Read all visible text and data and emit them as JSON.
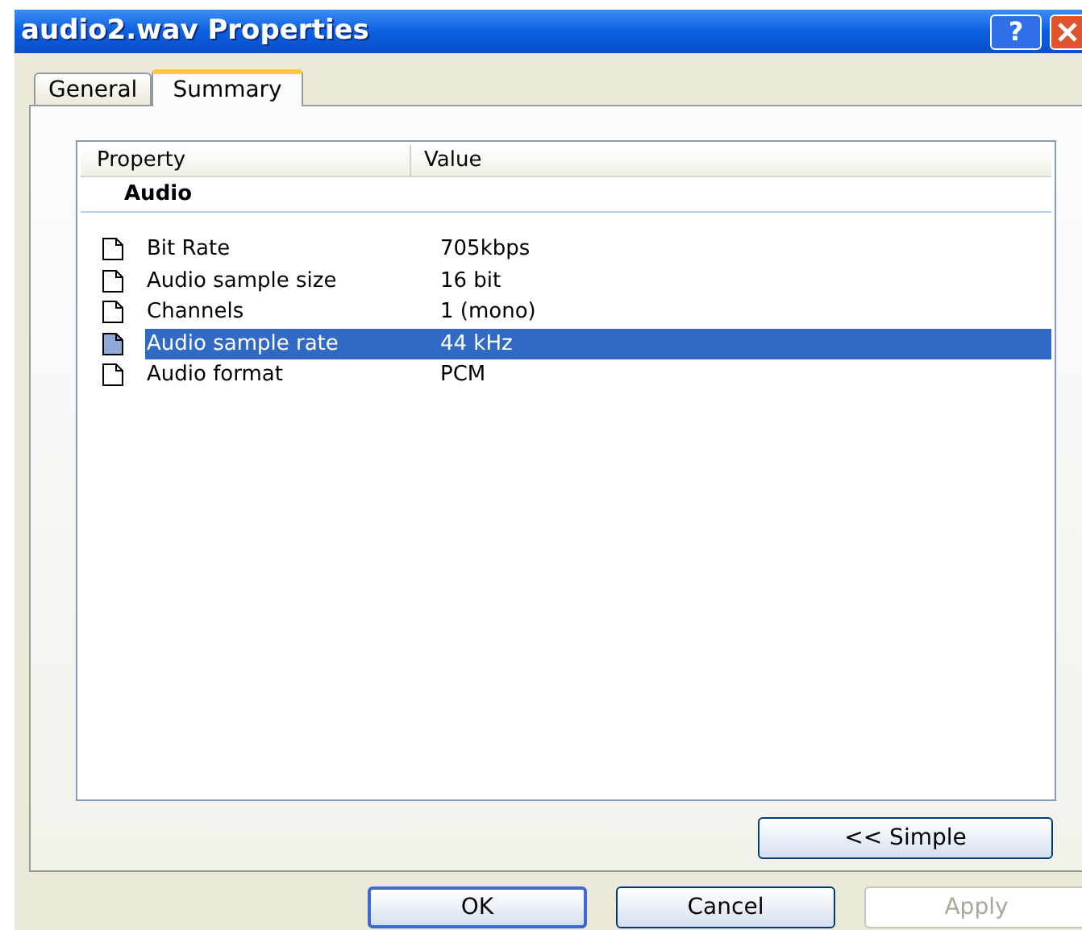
{
  "window": {
    "title": "audio2.wav Properties",
    "help_button": "?"
  },
  "tabs": [
    {
      "label": "General",
      "selected": false
    },
    {
      "label": "Summary",
      "selected": true
    }
  ],
  "list": {
    "columns": [
      "Property",
      "Value"
    ],
    "group": "Audio",
    "rows": [
      {
        "property": "Bit Rate",
        "value": "705kbps",
        "selected": false
      },
      {
        "property": "Audio sample size",
        "value": "16 bit",
        "selected": false
      },
      {
        "property": "Channels",
        "value": "1 (mono)",
        "selected": false
      },
      {
        "property": "Audio sample rate",
        "value": "44 kHz",
        "selected": true
      },
      {
        "property": "Audio format",
        "value": "PCM",
        "selected": false
      }
    ]
  },
  "simple_button": "<< Simple",
  "buttons": [
    {
      "label": "OK",
      "disabled": false,
      "default": true
    },
    {
      "label": "Cancel",
      "disabled": false,
      "default": false
    },
    {
      "label": "Apply",
      "disabled": true,
      "default": false
    }
  ]
}
